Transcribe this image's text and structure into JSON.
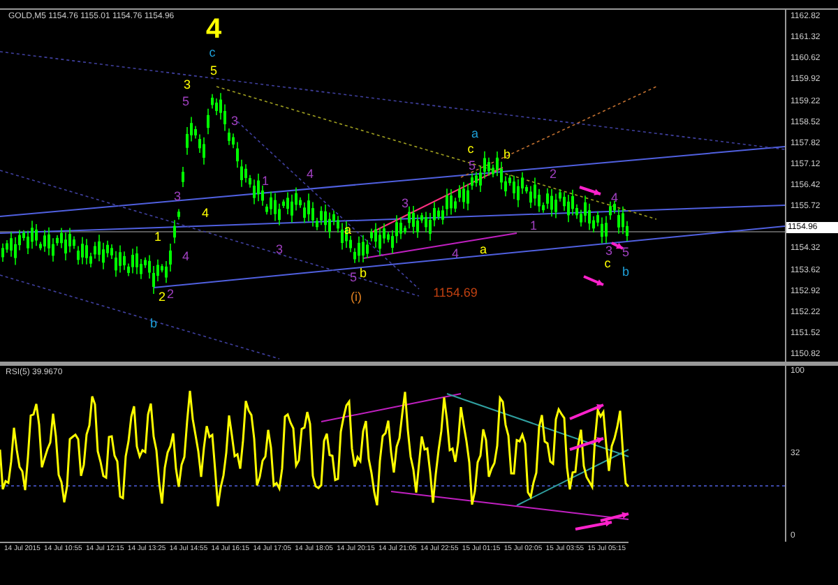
{
  "chart_header": "GOLD,M5  1154.76 1155.01 1154.76 1154.96",
  "price_axis": [
    {
      "text": "1162.82",
      "kind": "tick"
    },
    {
      "text": "1161.32",
      "kind": "tick"
    },
    {
      "text": "1160.62",
      "kind": "tick"
    },
    {
      "text": "1159.92",
      "kind": "tick"
    },
    {
      "text": "1159.22",
      "kind": "tick"
    },
    {
      "text": "1158.52",
      "kind": "tick"
    },
    {
      "text": "1157.82",
      "kind": "tick"
    },
    {
      "text": "1157.12",
      "kind": "tick"
    },
    {
      "text": "1156.42",
      "kind": "tick"
    },
    {
      "text": "1155.72",
      "kind": "tick"
    },
    {
      "text": "1154.96",
      "kind": "current"
    },
    {
      "text": "1154.32",
      "kind": "tick"
    },
    {
      "text": "1153.62",
      "kind": "tick"
    },
    {
      "text": "1152.92",
      "kind": "tick"
    },
    {
      "text": "1152.22",
      "kind": "tick"
    },
    {
      "text": "1151.52",
      "kind": "tick"
    },
    {
      "text": "1150.82",
      "kind": "tick"
    }
  ],
  "wave_labels": [
    {
      "text": "4",
      "color": "#ffff00"
    },
    {
      "text": "c",
      "color": "#1e9fd8"
    },
    {
      "text": "5",
      "color": "#ffff00"
    },
    {
      "text": "3",
      "color": "#ffff00"
    },
    {
      "text": "5",
      "color": "#a040c0"
    },
    {
      "text": "3",
      "color": "#a040c0"
    },
    {
      "text": "4",
      "color": "#a040c0"
    },
    {
      "text": "3",
      "color": "#a040c0"
    },
    {
      "text": "1",
      "color": "#a040c0"
    },
    {
      "text": "1",
      "color": "#ffff00"
    },
    {
      "text": "4",
      "color": "#ffff00"
    },
    {
      "text": "4",
      "color": "#a040c0"
    },
    {
      "text": "2",
      "color": "#ffff00"
    },
    {
      "text": "2",
      "color": "#a040c0"
    },
    {
      "text": "b",
      "color": "#1e9fd8"
    },
    {
      "text": "3",
      "color": "#a040c0"
    },
    {
      "text": "a",
      "color": "#ffff00"
    },
    {
      "text": "3",
      "color": "#a040c0"
    },
    {
      "text": "b",
      "color": "#ffff00"
    },
    {
      "text": "5",
      "color": "#a040c0"
    },
    {
      "text": "(i)",
      "color": "#e08020"
    },
    {
      "text": "a",
      "color": "#1e9fd8"
    },
    {
      "text": "c",
      "color": "#ffff00"
    },
    {
      "text": "5",
      "color": "#a040c0"
    },
    {
      "text": "b",
      "color": "#ffff00"
    },
    {
      "text": "2",
      "color": "#a040c0"
    },
    {
      "text": "4",
      "color": "#a040c0"
    },
    {
      "text": "a",
      "color": "#ffff00"
    },
    {
      "text": "1",
      "color": "#a040c0"
    },
    {
      "text": "4",
      "color": "#a040c0"
    },
    {
      "text": "3",
      "color": "#a040c0"
    },
    {
      "text": "5",
      "color": "#a040c0"
    },
    {
      "text": "c",
      "color": "#ffff00"
    },
    {
      "text": "b",
      "color": "#1e9fd8"
    },
    {
      "text": "1154.69",
      "color": "#c04010"
    }
  ],
  "rsi_panel": {
    "title": "RSI(5) 39.9670",
    "axis_labels": [
      "100",
      "32",
      "0"
    ]
  },
  "time_axis": [
    "14 Jul 2015",
    "14 Jul 10:55",
    "14 Jul 12:15",
    "14 Jul 13:25",
    "14 Jul 14:55",
    "14 Jul 16:15",
    "14 Jul 17:05",
    "14 Jul 18:05",
    "14 Jul 20:15",
    "14 Jul 21:05",
    "14 Jul 22:55",
    "15 Jul 01:15",
    "15 Jul 02:05",
    "15 Jul 03:55",
    "15 Jul 05:15"
  ]
}
